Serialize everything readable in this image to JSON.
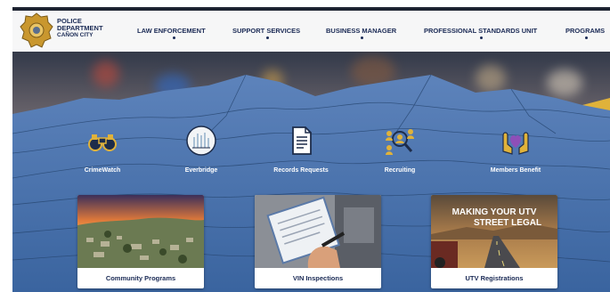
{
  "brand": {
    "line1": "POLICE",
    "line2": "DEPARTMENT",
    "line3": "CAÑON CITY",
    "badge_icon": "police-badge-icon"
  },
  "nav": {
    "items": [
      {
        "label": "LAW ENFORCEMENT"
      },
      {
        "label": "SUPPORT SERVICES"
      },
      {
        "label": "BUSINESS MANAGER"
      },
      {
        "label": "PROFESSIONAL STANDARDS UNIT"
      },
      {
        "label": "PROGRAMS"
      }
    ]
  },
  "quick_links": [
    {
      "label": "CrimeWatch",
      "icon": "binoculars-icon"
    },
    {
      "label": "Everbridge",
      "icon": "everbridge-icon"
    },
    {
      "label": "Records Requests",
      "icon": "document-icon"
    },
    {
      "label": "Recruiting",
      "icon": "recruiting-icon"
    },
    {
      "label": "Members Benefit",
      "icon": "heart-hands-icon"
    }
  ],
  "cards": [
    {
      "caption": "Community Programs",
      "image": "sunset-town-photo"
    },
    {
      "caption": "VIN Inspections",
      "image": "clipboard-inspection-photo"
    },
    {
      "caption": "UTV Registrations",
      "image": "utv-street-legal-photo",
      "overlay_line1": "MAKING YOUR UTV",
      "overlay_line2": "STREET LEGAL"
    }
  ],
  "colors": {
    "panel_blue": "#3f6aa6",
    "navy": "#1a2a55",
    "gold": "#e0b23a"
  }
}
